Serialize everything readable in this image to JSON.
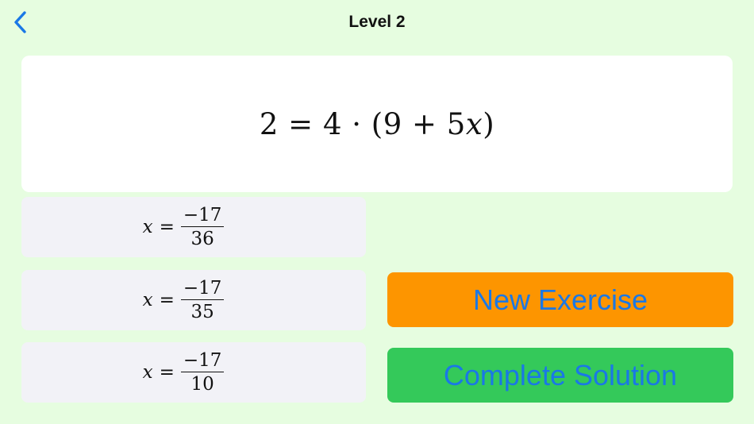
{
  "nav": {
    "title": "Level 2",
    "back_icon": "chevron-left-icon"
  },
  "equation": {
    "lhs": "2",
    "equals": "=",
    "rhs_coef": "4",
    "dot": "·",
    "paren_open": "(9 + 5",
    "variable": "x",
    "paren_close": ")"
  },
  "answers": [
    {
      "variable": "x",
      "equals": "=",
      "numerator": "−17",
      "denominator": "36"
    },
    {
      "variable": "x",
      "equals": "=",
      "numerator": "−17",
      "denominator": "35"
    },
    {
      "variable": "x",
      "equals": "=",
      "numerator": "−17",
      "denominator": "10"
    }
  ],
  "buttons": {
    "new_exercise": "New Exercise",
    "complete_solution": "Complete Solution"
  },
  "colors": {
    "background": "#e6fde0",
    "accent_blue": "#1a78e6",
    "new_exercise_bg": "#fd9500",
    "complete_solution_bg": "#34c95a",
    "answer_bg": "#f2f2f7"
  }
}
